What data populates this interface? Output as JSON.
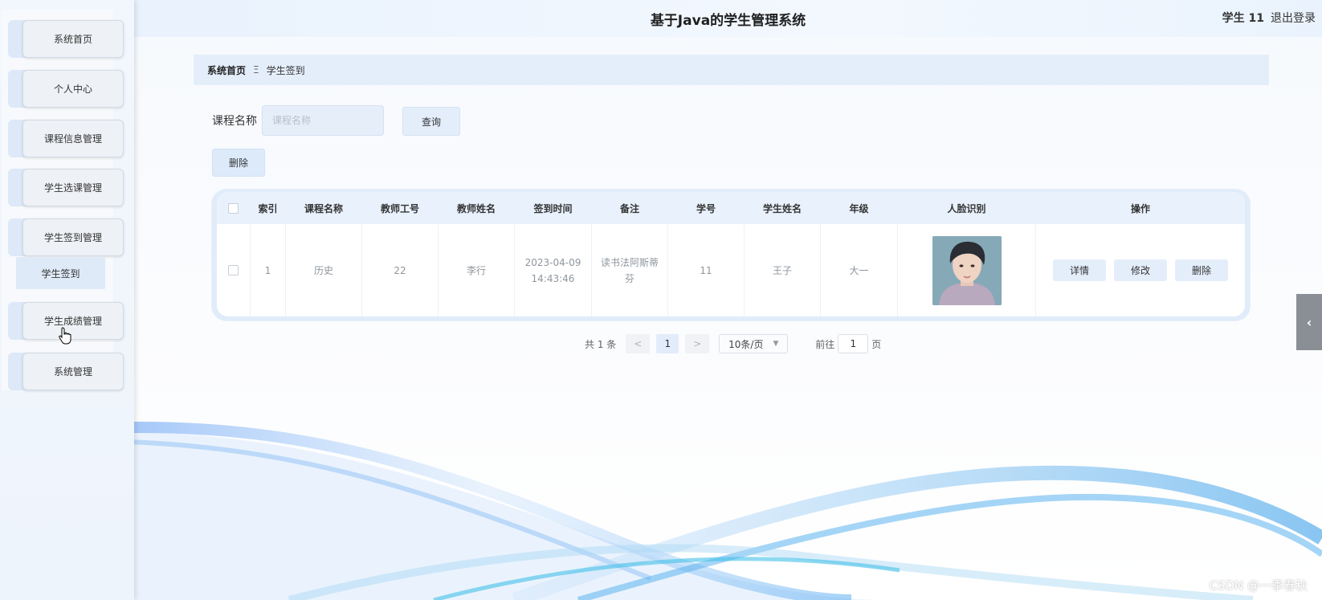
{
  "header": {
    "title": "基于Java的学生管理系统",
    "user": "学生 11",
    "logout": "退出登录"
  },
  "sidebar": {
    "items": [
      {
        "label": "系统首页"
      },
      {
        "label": "个人中心"
      },
      {
        "label": "课程信息管理"
      },
      {
        "label": "学生选课管理"
      },
      {
        "label": "学生签到管理"
      },
      {
        "label": "学生成绩管理"
      },
      {
        "label": "系统管理"
      }
    ],
    "submenu": {
      "label": "学生签到"
    }
  },
  "breadcrumb": {
    "home": "系统首页",
    "separator": "Ξ",
    "current": "学生签到"
  },
  "search": {
    "label": "课程名称",
    "placeholder": "课程名称",
    "query_button": "查询",
    "delete_button": "删除"
  },
  "table": {
    "headers": [
      "索引",
      "课程名称",
      "教师工号",
      "教师姓名",
      "签到时间",
      "备注",
      "学号",
      "学生姓名",
      "年级",
      "人脸识别",
      "操作"
    ],
    "rows": [
      {
        "index": "1",
        "course": "历史",
        "teacher_id": "22",
        "teacher_name": "李行",
        "time": "2023-04-09 14:43:46",
        "remark": "读书法阿斯蒂芬",
        "student_id": "11",
        "student_name": "王子",
        "grade": "大一",
        "actions": {
          "detail": "详情",
          "edit": "修改",
          "delete": "删除"
        }
      }
    ]
  },
  "pagination": {
    "total": "共 1 条",
    "prev": "<",
    "current_page": "1",
    "next": ">",
    "page_size": "10条/页",
    "goto_label": "前往",
    "goto_value": "1",
    "page_label": "页"
  },
  "watermark": "CSDN @一季春秋",
  "colors": {
    "accent": "#e4eefb",
    "sidebar_bg": "#eef4fc",
    "header_bg": "#e9f2fd"
  }
}
